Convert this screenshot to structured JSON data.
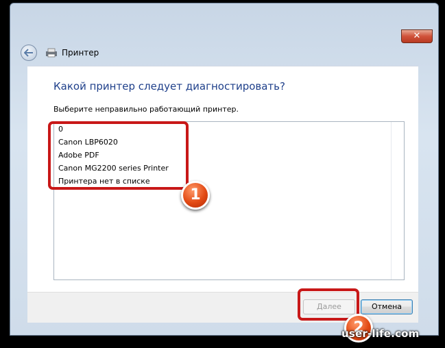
{
  "window": {
    "title": "Принтер",
    "close_label": "✕"
  },
  "main": {
    "heading": "Какой принтер следует диагностировать?",
    "instruction": "Выберите неправильно работающий принтер.",
    "printers": [
      "0",
      "Canon LBP6020",
      "Adobe PDF",
      "Canon MG2200 series Printer",
      "Принтера нет в списке"
    ]
  },
  "buttons": {
    "next_label": "Далее",
    "cancel_label": "Отмена"
  },
  "annotations": {
    "step1": "1",
    "step2": "2",
    "highlight_color": "#c81818",
    "badge_color": "#e24a14"
  },
  "watermark": "user-life.com"
}
